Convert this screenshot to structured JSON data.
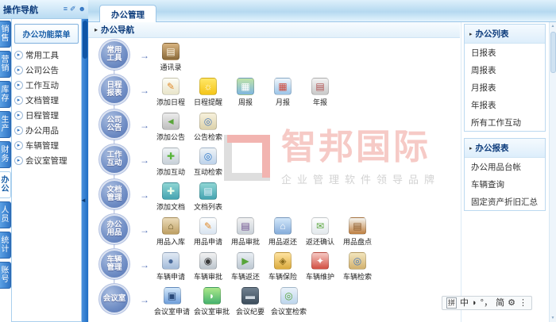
{
  "left_nav": {
    "header": {
      "title": "操作导航",
      "icons": [
        {
          "name": "list-view-icon",
          "glyph": "≡"
        },
        {
          "name": "pin-icon",
          "glyph": "✐"
        },
        {
          "name": "user-icon",
          "glyph": "☻"
        }
      ]
    },
    "tabs": [
      {
        "key": "sales",
        "label": "销售",
        "selected": false
      },
      {
        "key": "marketing",
        "label": "营销",
        "selected": false
      },
      {
        "key": "inventory",
        "label": "库存",
        "selected": false
      },
      {
        "key": "production",
        "label": "生产",
        "selected": false
      },
      {
        "key": "finance",
        "label": "财务",
        "selected": false
      },
      {
        "key": "office",
        "label": "办公",
        "selected": true
      },
      {
        "key": "personnel",
        "label": "人员",
        "selected": false
      },
      {
        "key": "statistics",
        "label": "统计",
        "selected": false
      },
      {
        "key": "account",
        "label": "账号",
        "selected": false
      }
    ],
    "menu_button": "办公功能菜单",
    "menu_items": [
      {
        "key": "common-tools",
        "label": "常用工具"
      },
      {
        "key": "company-announcement",
        "label": "公司公告"
      },
      {
        "key": "work-interaction",
        "label": "工作互动"
      },
      {
        "key": "document-management",
        "label": "文档管理"
      },
      {
        "key": "schedule-management",
        "label": "日程管理"
      },
      {
        "key": "office-supplies",
        "label": "办公用品"
      },
      {
        "key": "vehicle-management",
        "label": "车辆管理"
      },
      {
        "key": "meeting-room-management",
        "label": "会议室管理"
      }
    ]
  },
  "main": {
    "tab": "办公管理",
    "section_title": "办公导航",
    "rows": [
      {
        "key": "common-tools",
        "category": [
          "常用",
          "工具"
        ],
        "items": [
          {
            "label": "通讯录",
            "icon": "address-book-icon"
          }
        ]
      },
      {
        "key": "schedule-report",
        "category": [
          "日程",
          "报表"
        ],
        "items": [
          {
            "label": "添加日程",
            "icon": "notepad-pencil-icon"
          },
          {
            "label": "日程提醒",
            "icon": "lightbulb-icon"
          },
          {
            "label": "周报",
            "icon": "calendar-week-icon"
          },
          {
            "label": "月报",
            "icon": "calendar-month-icon"
          },
          {
            "label": "年报",
            "icon": "report-doc-icon"
          }
        ]
      },
      {
        "key": "company-announcement",
        "category": [
          "公司",
          "公告"
        ],
        "items": [
          {
            "label": "添加公告",
            "icon": "megaphone-icon"
          },
          {
            "label": "公告检索",
            "icon": "doc-search-icon"
          }
        ]
      },
      {
        "key": "work-interaction",
        "category": [
          "工作",
          "互动"
        ],
        "items": [
          {
            "label": "添加互动",
            "icon": "board-add-icon"
          },
          {
            "label": "互动检索",
            "icon": "board-search-icon"
          }
        ]
      },
      {
        "key": "document-management",
        "category": [
          "文档",
          "管理"
        ],
        "items": [
          {
            "label": "添加文档",
            "icon": "folder-add-icon"
          },
          {
            "label": "文档列表",
            "icon": "folder-doc-icon"
          }
        ]
      },
      {
        "key": "office-supplies",
        "category": [
          "办公",
          "用品"
        ],
        "items": [
          {
            "label": "用品入库",
            "icon": "warehouse-icon"
          },
          {
            "label": "用品申请",
            "icon": "form-pencil-icon"
          },
          {
            "label": "用品审批",
            "icon": "form-person-icon"
          },
          {
            "label": "用品返还",
            "icon": "shop-icon"
          },
          {
            "label": "返还确认",
            "icon": "mail-check-icon"
          },
          {
            "label": "用品盘点",
            "icon": "clipboard-icon"
          }
        ]
      },
      {
        "key": "vehicle-management",
        "category": [
          "车辆",
          "管理"
        ],
        "items": [
          {
            "label": "车辆申请",
            "icon": "car-person-icon"
          },
          {
            "label": "车辆审批",
            "icon": "camera-icon"
          },
          {
            "label": "车辆返还",
            "icon": "truck-icon"
          },
          {
            "label": "车辆保险",
            "icon": "padlock-icon"
          },
          {
            "label": "车辆维护",
            "icon": "car-wrench-icon"
          },
          {
            "label": "车辆检索",
            "icon": "folder-search-icon"
          }
        ]
      },
      {
        "key": "meeting-room",
        "category": [
          "会议室"
        ],
        "items": [
          {
            "label": "会议室申请",
            "icon": "screen-icon"
          },
          {
            "label": "会议室审批",
            "icon": "chat-bubbles-icon"
          },
          {
            "label": "会议纪要",
            "icon": "card-icon"
          },
          {
            "label": "会议室检索",
            "icon": "search-icon"
          }
        ]
      }
    ]
  },
  "right_panel": {
    "boxes": [
      {
        "key": "office-lists",
        "title": "办公列表",
        "items": [
          "日报表",
          "周报表",
          "月报表",
          "年报表",
          "所有工作互动"
        ]
      },
      {
        "key": "office-reports",
        "title": "办公报表",
        "items": [
          "办公用品台帐",
          "车辆查询",
          "固定资产折旧汇总"
        ]
      }
    ]
  },
  "watermark": {
    "brand": "智邦国际",
    "slogan": "企业管理软件领导品牌"
  },
  "ime_bar": {
    "items": [
      {
        "name": "ime-input-mode-icon",
        "label": "拼"
      },
      {
        "name": "ime-lang-chinese",
        "label": "中"
      },
      {
        "name": "ime-halfwidth-icon",
        "label": "◗"
      },
      {
        "name": "ime-punctuation-icon",
        "label": "°，"
      },
      {
        "name": "ime-simplified-icon",
        "label": "简"
      },
      {
        "name": "ime-settings-icon",
        "label": "⚙"
      },
      {
        "name": "ime-more-icon",
        "label": "⋮"
      }
    ]
  },
  "colors": {
    "accent_blue": "#2a6fc0",
    "header_text": "#0d3c7c",
    "watermark_red": "#f6cac6"
  }
}
